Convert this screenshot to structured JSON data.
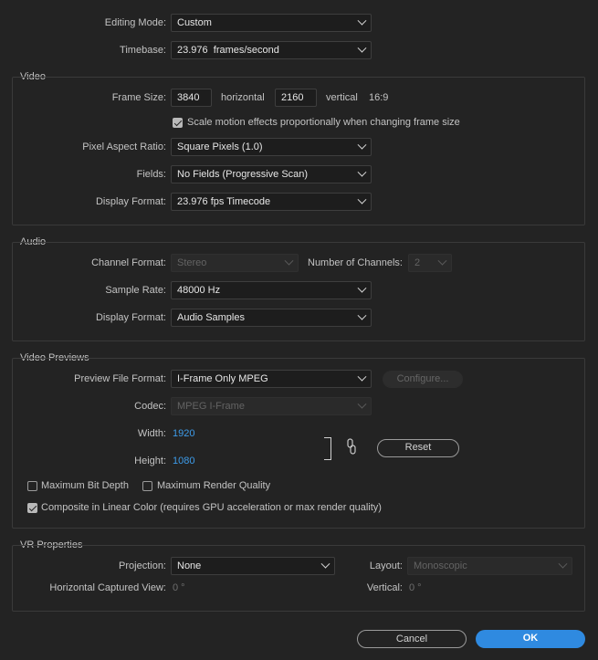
{
  "general": {
    "editing_mode_label": "Editing Mode:",
    "editing_mode_value": "Custom",
    "timebase_label": "Timebase:",
    "timebase_value": "23.976  frames/second"
  },
  "video": {
    "title": "Video",
    "frame_size_label": "Frame Size:",
    "width": "3840",
    "horizontal_label": "horizontal",
    "height": "2160",
    "vertical_label": "vertical",
    "ratio": "16:9",
    "scale_motion_label": "Scale motion effects proportionally when changing frame size",
    "scale_motion_checked": true,
    "pixel_aspect_label": "Pixel Aspect Ratio:",
    "pixel_aspect_value": "Square Pixels (1.0)",
    "fields_label": "Fields:",
    "fields_value": "No Fields (Progressive Scan)",
    "display_format_label": "Display Format:",
    "display_format_value": "23.976 fps Timecode"
  },
  "audio": {
    "title": "Audio",
    "channel_format_label": "Channel Format:",
    "channel_format_value": "Stereo",
    "num_channels_label": "Number of Channels:",
    "num_channels_value": "2",
    "sample_rate_label": "Sample Rate:",
    "sample_rate_value": "48000 Hz",
    "display_format_label": "Display Format:",
    "display_format_value": "Audio Samples"
  },
  "previews": {
    "title": "Video Previews",
    "file_format_label": "Preview File Format:",
    "file_format_value": "I-Frame Only MPEG",
    "configure_label": "Configure...",
    "codec_label": "Codec:",
    "codec_value": "MPEG I-Frame",
    "width_label": "Width:",
    "width_value": "1920",
    "height_label": "Height:",
    "height_value": "1080",
    "reset_label": "Reset",
    "max_bit_depth_label": "Maximum Bit Depth",
    "max_bit_depth_checked": false,
    "max_render_quality_label": "Maximum Render Quality",
    "max_render_quality_checked": false,
    "composite_linear_label": "Composite in Linear Color (requires GPU acceleration or max render quality)",
    "composite_linear_checked": true
  },
  "vr": {
    "title": "VR Properties",
    "projection_label": "Projection:",
    "projection_value": "None",
    "layout_label": "Layout:",
    "layout_value": "Monoscopic",
    "h_captured_label": "Horizontal Captured View:",
    "h_captured_value": "0 °",
    "vertical_label": "Vertical:",
    "vertical_value": "0 °"
  },
  "footer": {
    "cancel_label": "Cancel",
    "ok_label": "OK"
  },
  "colors": {
    "background": "#232323",
    "accent": "#2f8ae0",
    "link_value": "#3d9be9"
  },
  "icons": {
    "link": "link-chain-icon",
    "chevron": "chevron-down-icon"
  }
}
